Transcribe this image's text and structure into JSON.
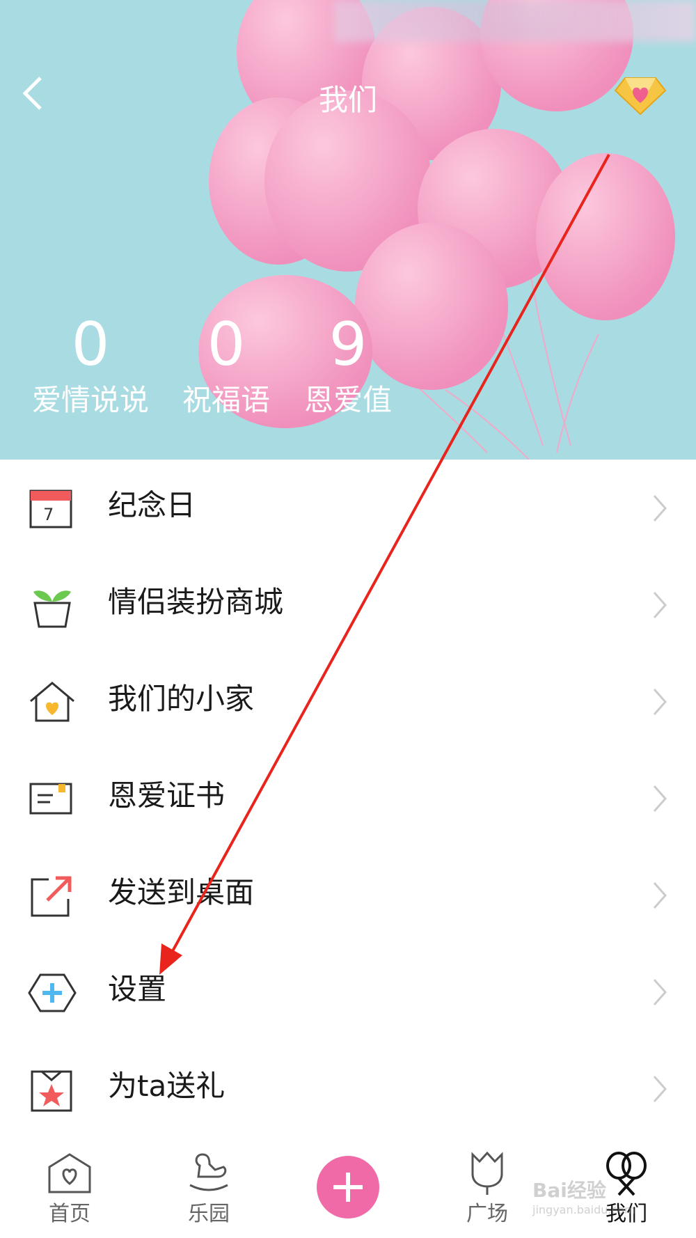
{
  "header": {
    "title": "我们",
    "back_icon": "chevron-left-icon",
    "gem_icon": "diamond-heart-icon"
  },
  "stats": [
    {
      "value": "0",
      "label": "爱情说说"
    },
    {
      "value": "0",
      "label": "祝福语"
    },
    {
      "value": "9",
      "label": "恩爱值"
    }
  ],
  "menu": [
    {
      "label": "纪念日",
      "icon": "calendar-icon"
    },
    {
      "label": "情侣装扮商城",
      "icon": "plant-pot-icon"
    },
    {
      "label": "我们的小家",
      "icon": "house-heart-icon"
    },
    {
      "label": "恩爱证书",
      "icon": "certificate-icon"
    },
    {
      "label": "发送到桌面",
      "icon": "share-out-icon"
    },
    {
      "label": "设置",
      "icon": "settings-hexagon-icon"
    },
    {
      "label": "为ta送礼",
      "icon": "gift-star-icon"
    }
  ],
  "tabs": [
    {
      "label": "首页",
      "icon": "home-heart-icon"
    },
    {
      "label": "乐园",
      "icon": "rocking-horse-icon"
    },
    {
      "label": "",
      "icon": "plus-icon"
    },
    {
      "label": "广场",
      "icon": "tulip-icon"
    },
    {
      "label": "我们",
      "icon": "couple-balloon-icon"
    }
  ],
  "watermark": {
    "line1": "Bai经验",
    "line2": "jingyan.baidu.com"
  },
  "colors": {
    "hero_bg": "#a9dce2",
    "balloon": "#f5a3c7",
    "accent_pink": "#f06aa7",
    "arrow": "#e8241c"
  }
}
